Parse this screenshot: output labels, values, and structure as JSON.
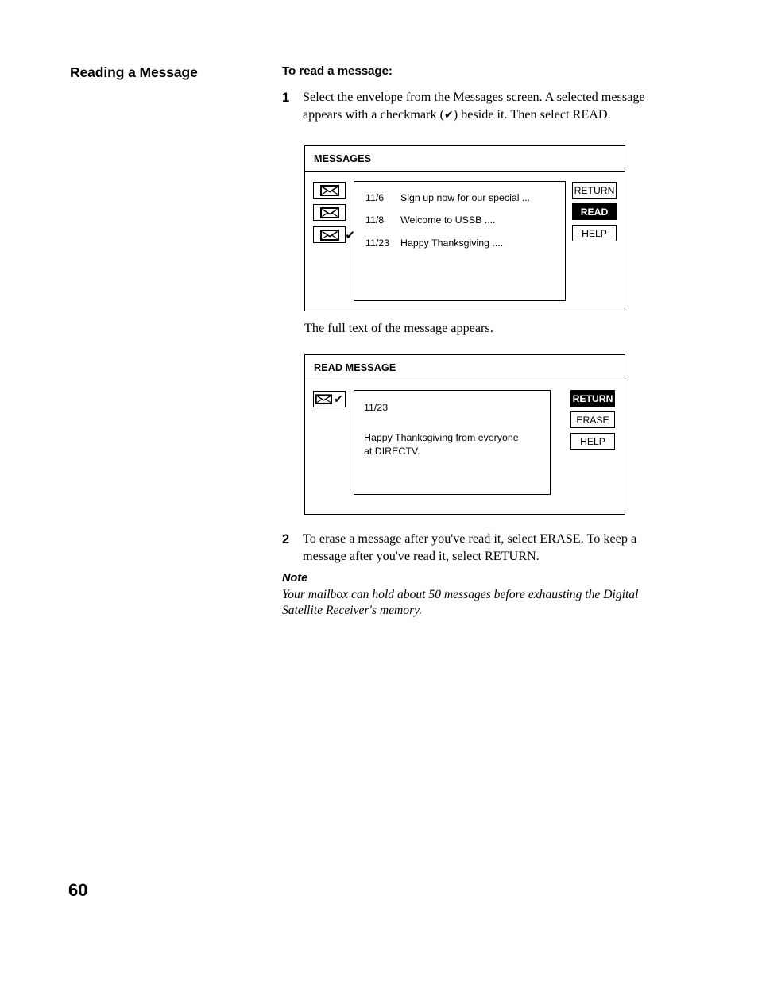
{
  "page": {
    "section_heading": "Reading a Message",
    "page_number": "60"
  },
  "procedure": {
    "heading": "To read a message:",
    "steps": [
      {
        "number": "1",
        "text_before_check": "Select the envelope from the Messages screen. A selected message appears with a checkmark (",
        "check_glyph": "✔",
        "text_after_check": ") beside it. Then select READ."
      },
      {
        "number": "2",
        "text": "To erase a message after you've read it, select ERASE. To keep a message after you've read it, select RETURN."
      }
    ],
    "caption": "The full text of the message appears."
  },
  "note": {
    "title": "Note",
    "body": "Your mailbox can hold about 50 messages before exhausting the Digital Satellite Receiver's memory."
  },
  "messages_screen": {
    "title": "MESSAGES",
    "envelope_icon": "envelope-icon",
    "check_glyph": "✔",
    "rows": [
      {
        "date": "11/6",
        "subject": "Sign up now for our special ...",
        "selected": false
      },
      {
        "date": "11/8",
        "subject": "Welcome to USSB ....",
        "selected": false
      },
      {
        "date": "11/23",
        "subject": "Happy Thanksgiving ....",
        "selected": true
      }
    ],
    "buttons": [
      {
        "label": "RETURN",
        "selected": false
      },
      {
        "label": "READ",
        "selected": true
      },
      {
        "label": "HELP",
        "selected": false
      }
    ]
  },
  "read_screen": {
    "title": "READ MESSAGE",
    "envelope_icon": "envelope-icon",
    "check_glyph": "✔",
    "date": "11/23",
    "body_line_1": "Happy Thanksgiving from everyone",
    "body_line_2": "at DIRECTV.",
    "buttons": [
      {
        "label": "RETURN",
        "selected": true
      },
      {
        "label": "ERASE",
        "selected": false
      },
      {
        "label": "HELP",
        "selected": false
      }
    ]
  },
  "colors": {
    "ink": "#000000",
    "paper": "#ffffff",
    "selected_bg": "#000000",
    "selected_fg": "#ffffff"
  }
}
